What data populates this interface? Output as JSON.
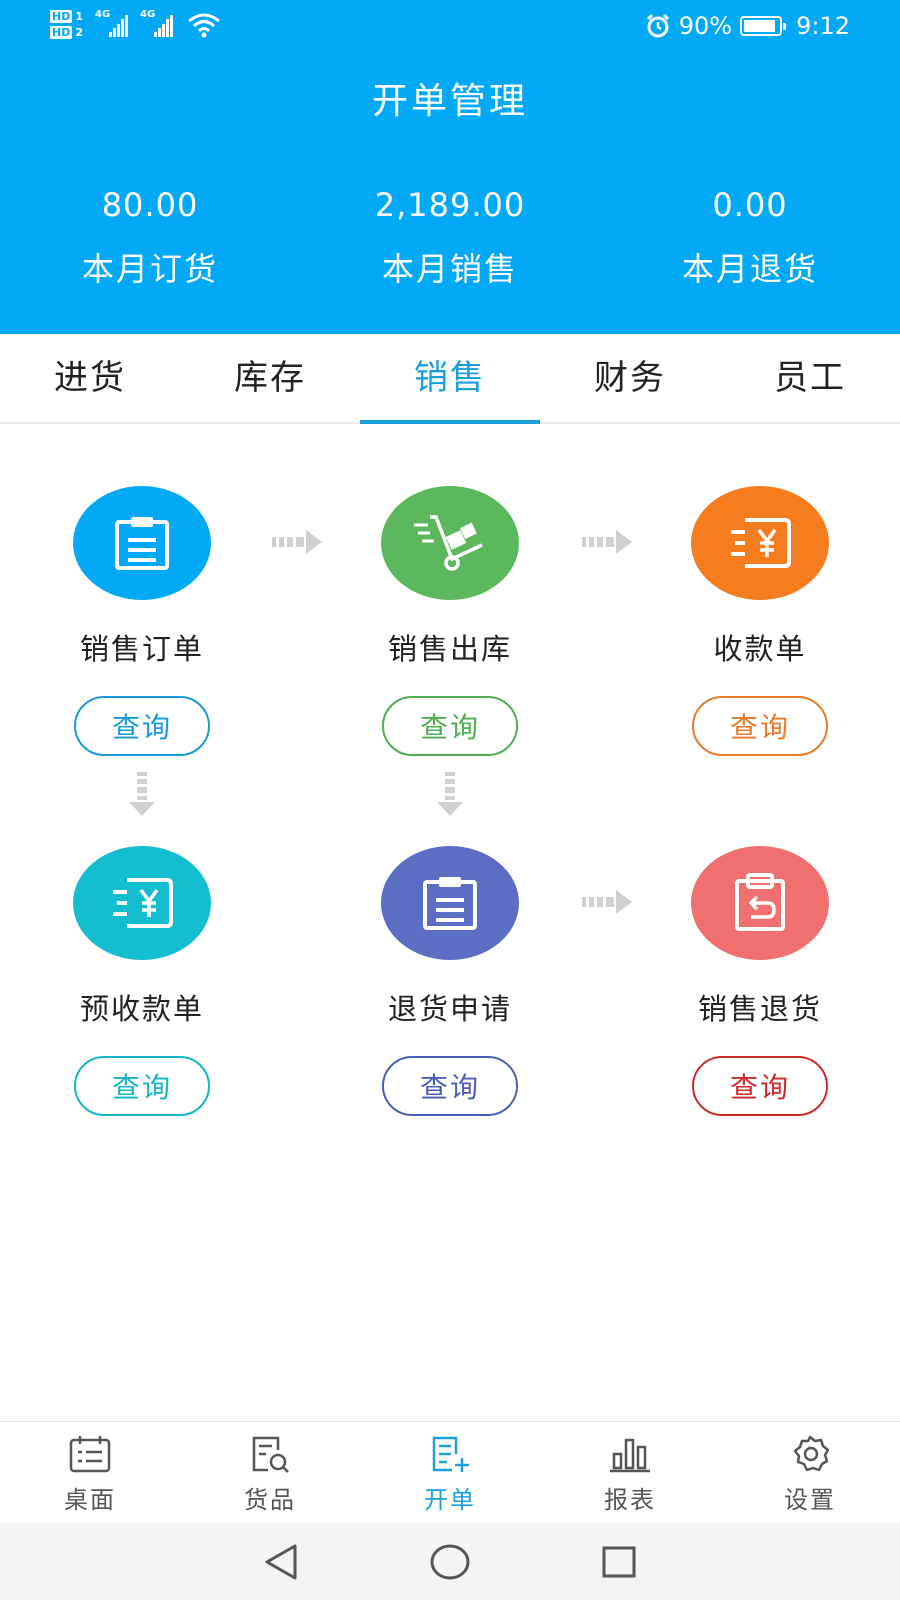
{
  "status_bar": {
    "hd1": "HD",
    "sim1": "1",
    "hd2": "HD",
    "sim2": "2",
    "net1": "4G",
    "net2": "4G",
    "battery_percent": "90%",
    "time": "9:12",
    "battery_level": 0.9
  },
  "header": {
    "title": "开单管理",
    "stats": [
      {
        "value": "80.00",
        "label": "本月订货"
      },
      {
        "value": "2,189.00",
        "label": "本月销售"
      },
      {
        "value": "0.00",
        "label": "本月退货"
      }
    ]
  },
  "tabs": [
    {
      "label": "进货"
    },
    {
      "label": "库存"
    },
    {
      "label": "销售"
    },
    {
      "label": "财务"
    },
    {
      "label": "员工"
    }
  ],
  "active_tab": "销售",
  "flow": {
    "query_label": "查询",
    "nodes": [
      {
        "label": "销售订单",
        "icon": "clipboard-icon",
        "color": "#03a9f4"
      },
      {
        "label": "销售出库",
        "icon": "hand-truck-icon",
        "color": "#5cb85c"
      },
      {
        "label": "收款单",
        "icon": "yuan-receipt-icon",
        "color": "#f57c1f"
      },
      {
        "label": "预收款单",
        "icon": "yuan-receipt-icon",
        "color": "#15bdd0"
      },
      {
        "label": "退货申请",
        "icon": "clipboard-icon",
        "color": "#5b6ec4"
      },
      {
        "label": "销售退货",
        "icon": "return-clipboard-icon",
        "color": "#f07070"
      }
    ],
    "button_colors": [
      "#1a9ad8",
      "#4fae50",
      "#e8782a",
      "#15b5c9",
      "#4b5fb8",
      "#cc2b2b"
    ]
  },
  "bottom_nav": [
    {
      "label": "桌面",
      "icon": "calendar-icon"
    },
    {
      "label": "货品",
      "icon": "product-search-icon"
    },
    {
      "label": "开单",
      "icon": "new-order-icon"
    },
    {
      "label": "报表",
      "icon": "bar-chart-icon"
    },
    {
      "label": "设置",
      "icon": "gear-icon"
    }
  ],
  "active_nav": "开单"
}
